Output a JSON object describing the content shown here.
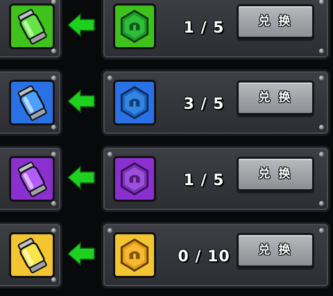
{
  "rows": [
    {
      "canister": "green",
      "gem": "green",
      "count": "1 / 5",
      "button_label": "兑 换",
      "color": "#3fc21c",
      "gem_color": "#1e9b2a"
    },
    {
      "canister": "blue",
      "gem": "blue",
      "count": "3 / 5",
      "button_label": "兑 换",
      "color": "#2a71e6",
      "gem_color": "#1c66c9"
    },
    {
      "canister": "purple",
      "gem": "purple",
      "count": "1 / 5",
      "button_label": "兑 换",
      "color": "#8b2fd1",
      "gem_color": "#7c2fb8"
    },
    {
      "canister": "yellow",
      "gem": "gold",
      "count": "0 / 10",
      "button_label": "兑 换",
      "color": "#f2c531",
      "gem_color": "#e59a10"
    }
  ],
  "icons": {
    "canister": "energy-canister-icon",
    "arrow": "left-arrow-icon",
    "gem": "helmet-gem-icon"
  }
}
